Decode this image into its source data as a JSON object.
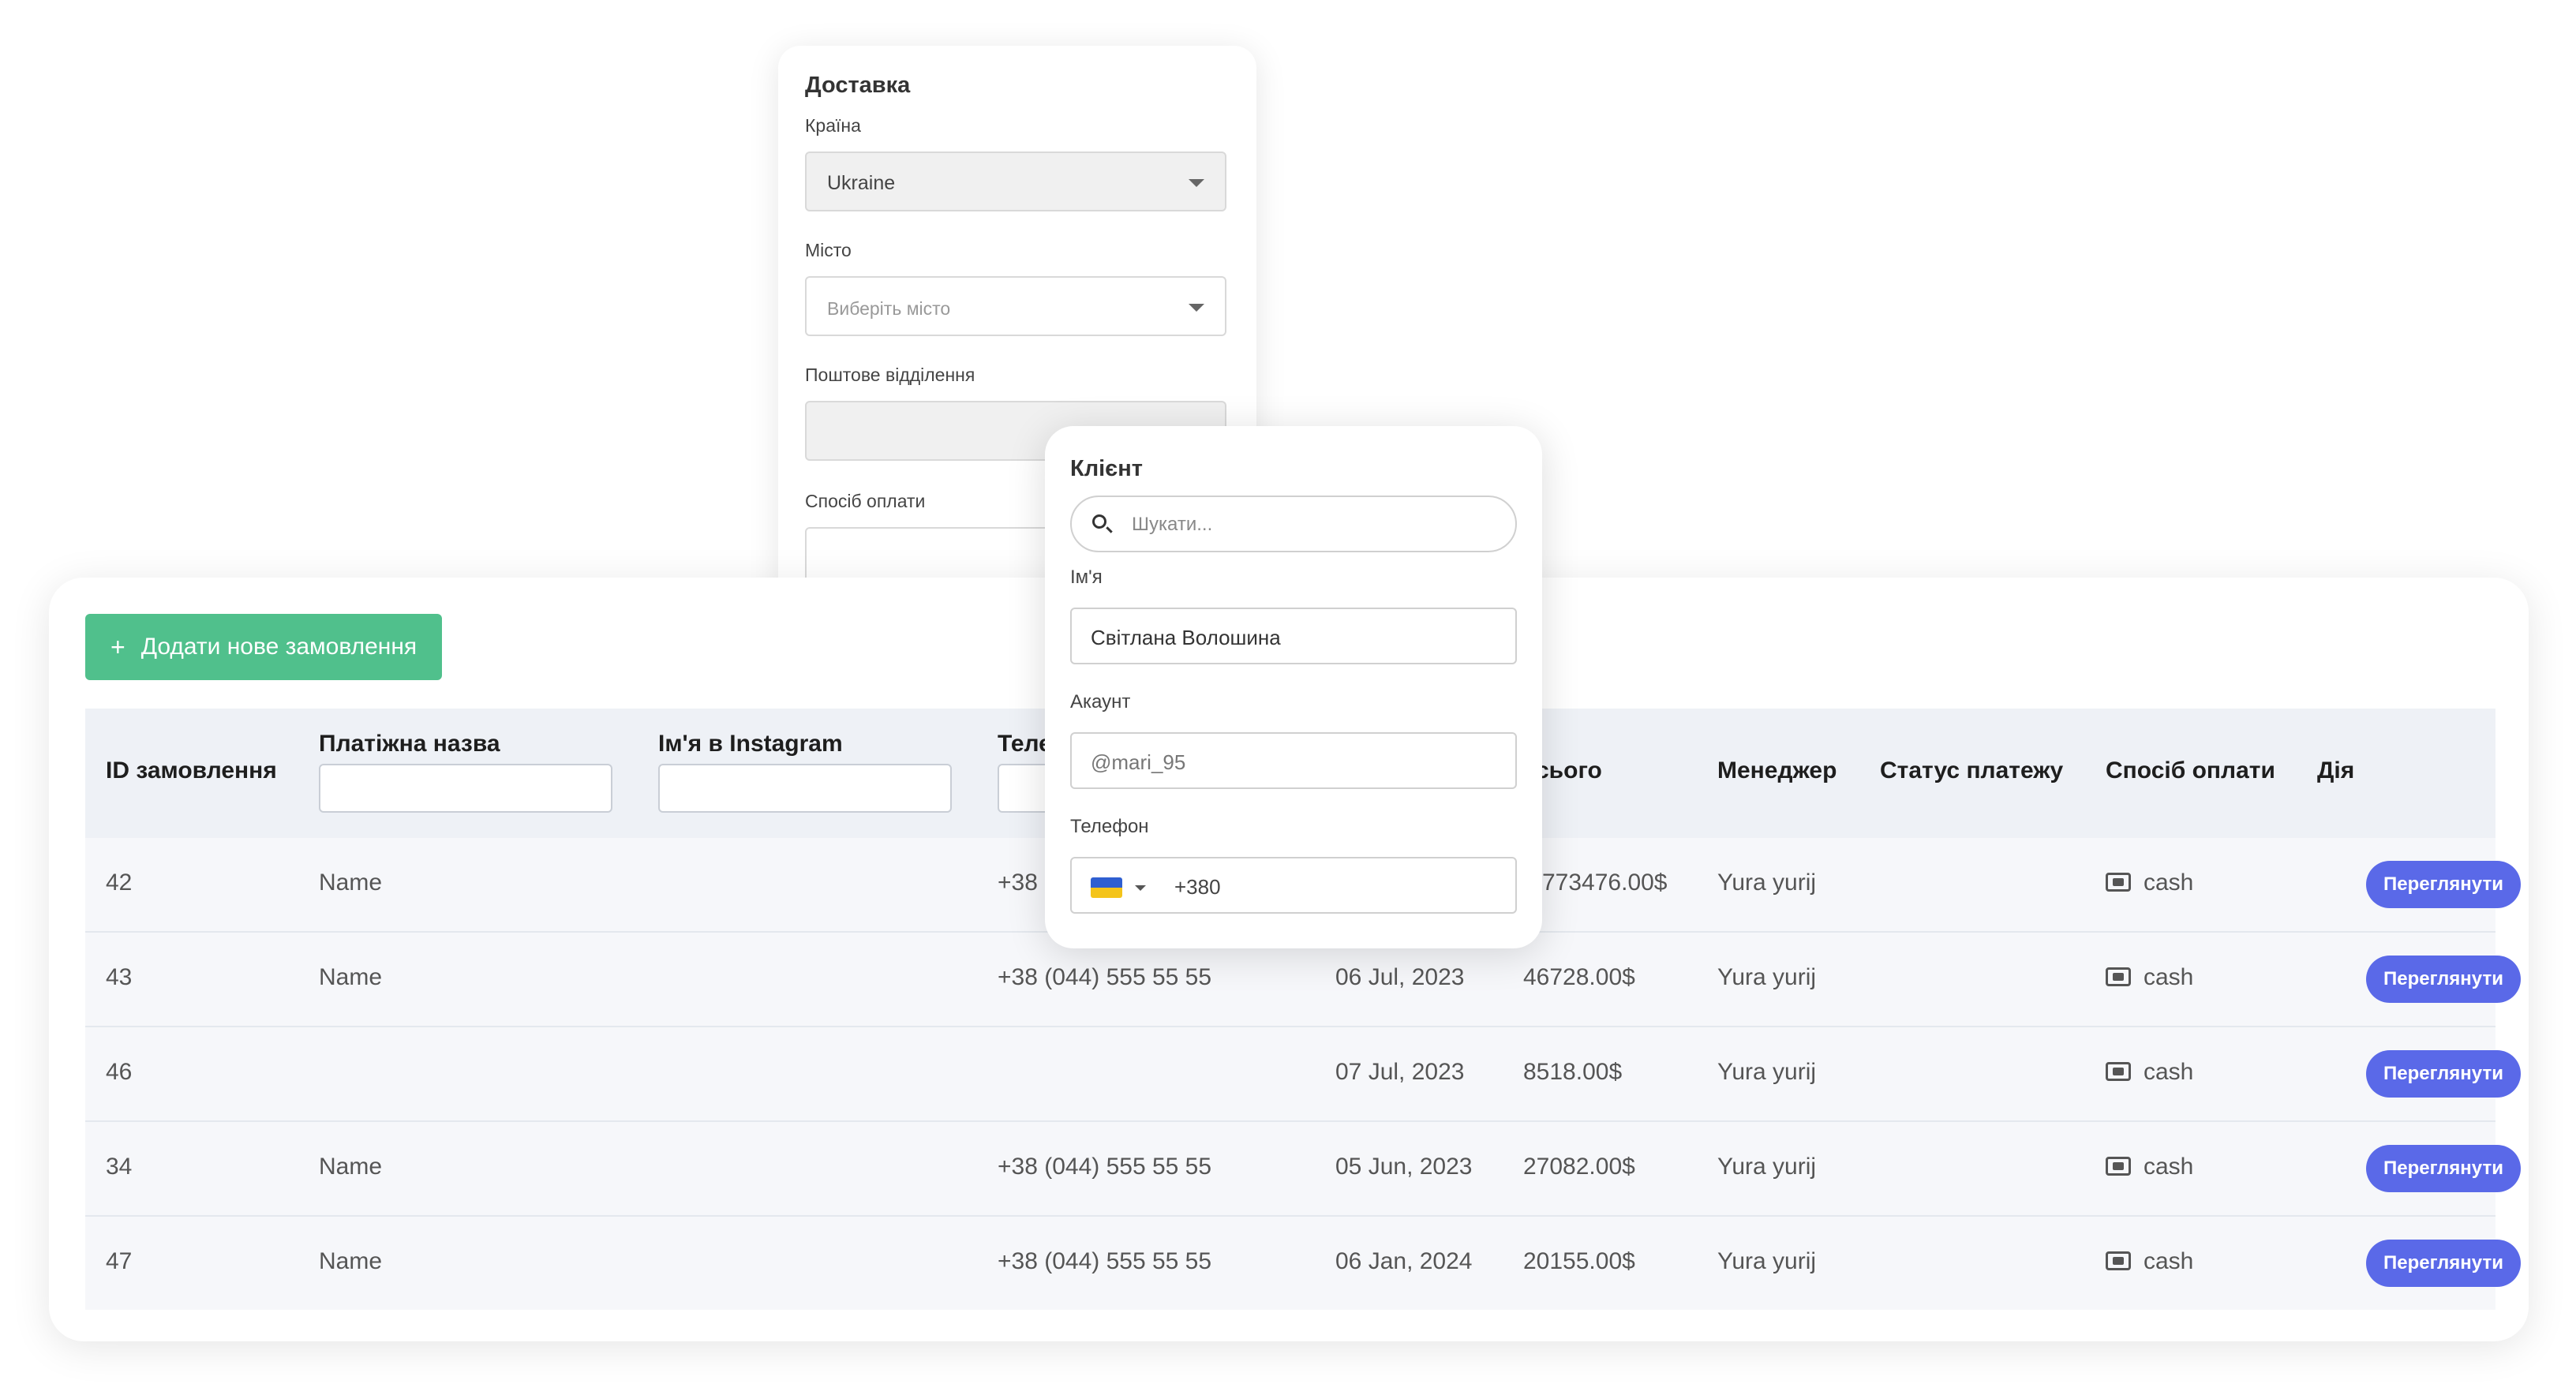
{
  "delivery": {
    "title": "Доставка",
    "country_label": "Країна",
    "country_value": "Ukraine",
    "city_label": "Місто",
    "city_placeholder": "Виберіть місто",
    "post_office_label": "Поштове відділення",
    "payment_method_label": "Спосіб оплати"
  },
  "orders": {
    "add_button_label": "Додати нове замовлення",
    "columns": {
      "id": "ID замовлення",
      "payer_name": "Платіжна назва",
      "instagram": "Ім'я в Instagram",
      "phone": "Теле",
      "total": "сього",
      "manager": "Менеджер",
      "payment_status": "Статус платежу",
      "payment_method": "Спосіб оплати",
      "action": "Дія"
    },
    "rows": [
      {
        "id": "42",
        "name": "Name",
        "phone": "+38",
        "date": "",
        "total": "773476.00$",
        "manager": "Yura yurij",
        "method": "cash",
        "action": "Переглянути"
      },
      {
        "id": "43",
        "name": "Name",
        "phone": "+38 (044) 555 55 55",
        "date": "06 Jul, 2023",
        "total": "46728.00$",
        "manager": "Yura yurij",
        "method": "cash",
        "action": "Переглянути"
      },
      {
        "id": "46",
        "name": "",
        "phone": "",
        "date": "07 Jul, 2023",
        "total": "8518.00$",
        "manager": "Yura yurij",
        "method": "cash",
        "action": "Переглянути"
      },
      {
        "id": "34",
        "name": "Name",
        "phone": "+38 (044) 555 55 55",
        "date": "05 Jun, 2023",
        "total": "27082.00$",
        "manager": "Yura yurij",
        "method": "cash",
        "action": "Переглянути"
      },
      {
        "id": "47",
        "name": "Name",
        "phone": "+38 (044) 555 55 55",
        "date": "06 Jan, 2024",
        "total": "20155.00$",
        "manager": "Yura yurij",
        "method": "cash",
        "action": "Переглянути"
      }
    ]
  },
  "client": {
    "title": "Клієнт",
    "search_placeholder": "Шукати...",
    "name_label": "Ім'я",
    "name_value": "Світлана Волошина",
    "account_label": "Акаунт",
    "account_value": "@mari_95",
    "phone_label": "Телефон",
    "phone_value": "+380",
    "flag_icon": "ukraine-flag-icon"
  },
  "colors": {
    "add_button": "#50c08c",
    "view_button": "#5a69e8",
    "table_header": "#eef1f6"
  }
}
